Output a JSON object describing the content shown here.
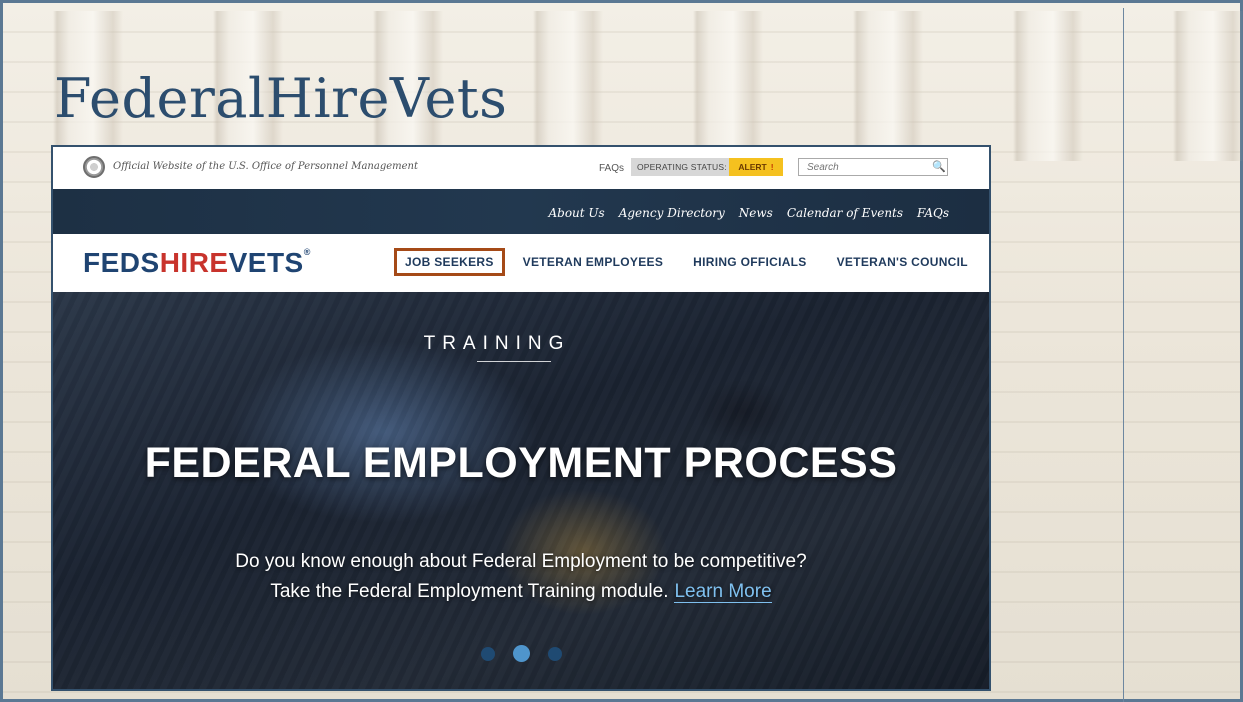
{
  "slide": {
    "title": "FederalHireVets"
  },
  "site": {
    "topbar": {
      "official_text": "Official Website of the U.S. Office of Personnel Management",
      "faqs": "FAQs",
      "operating_status": "OPERATING STATUS:",
      "alert": "ALERT",
      "alert_mark": "!",
      "search_placeholder": "Search"
    },
    "utility_nav": [
      "About Us",
      "Agency Directory",
      "News",
      "Calendar of Events",
      "FAQs"
    ],
    "logo": {
      "part1": "FEDS",
      "part2": "HIRE",
      "part3": "VETS",
      "reg": "®"
    },
    "main_nav": [
      {
        "label": "JOB SEEKERS",
        "highlighted": true
      },
      {
        "label": "VETERAN EMPLOYEES",
        "highlighted": false
      },
      {
        "label": "HIRING OFFICIALS",
        "highlighted": false
      },
      {
        "label": "VETERAN'S COUNCIL",
        "highlighted": false
      }
    ],
    "hero": {
      "kicker": "TRAINING",
      "title": "FEDERAL EMPLOYMENT PROCESS",
      "line1": "Do you know enough about Federal Employment to be competitive?",
      "line2": "Take the Federal Employment Training module.",
      "learn_more": "Learn More",
      "slides_total": 3,
      "active_slide": 2
    },
    "colors": {
      "highlight_box": "#a54a17",
      "logo_blue": "#1f4472",
      "logo_red": "#c8332c",
      "alert_yellow": "#f5c11f",
      "link_blue": "#7fc0ef"
    }
  }
}
